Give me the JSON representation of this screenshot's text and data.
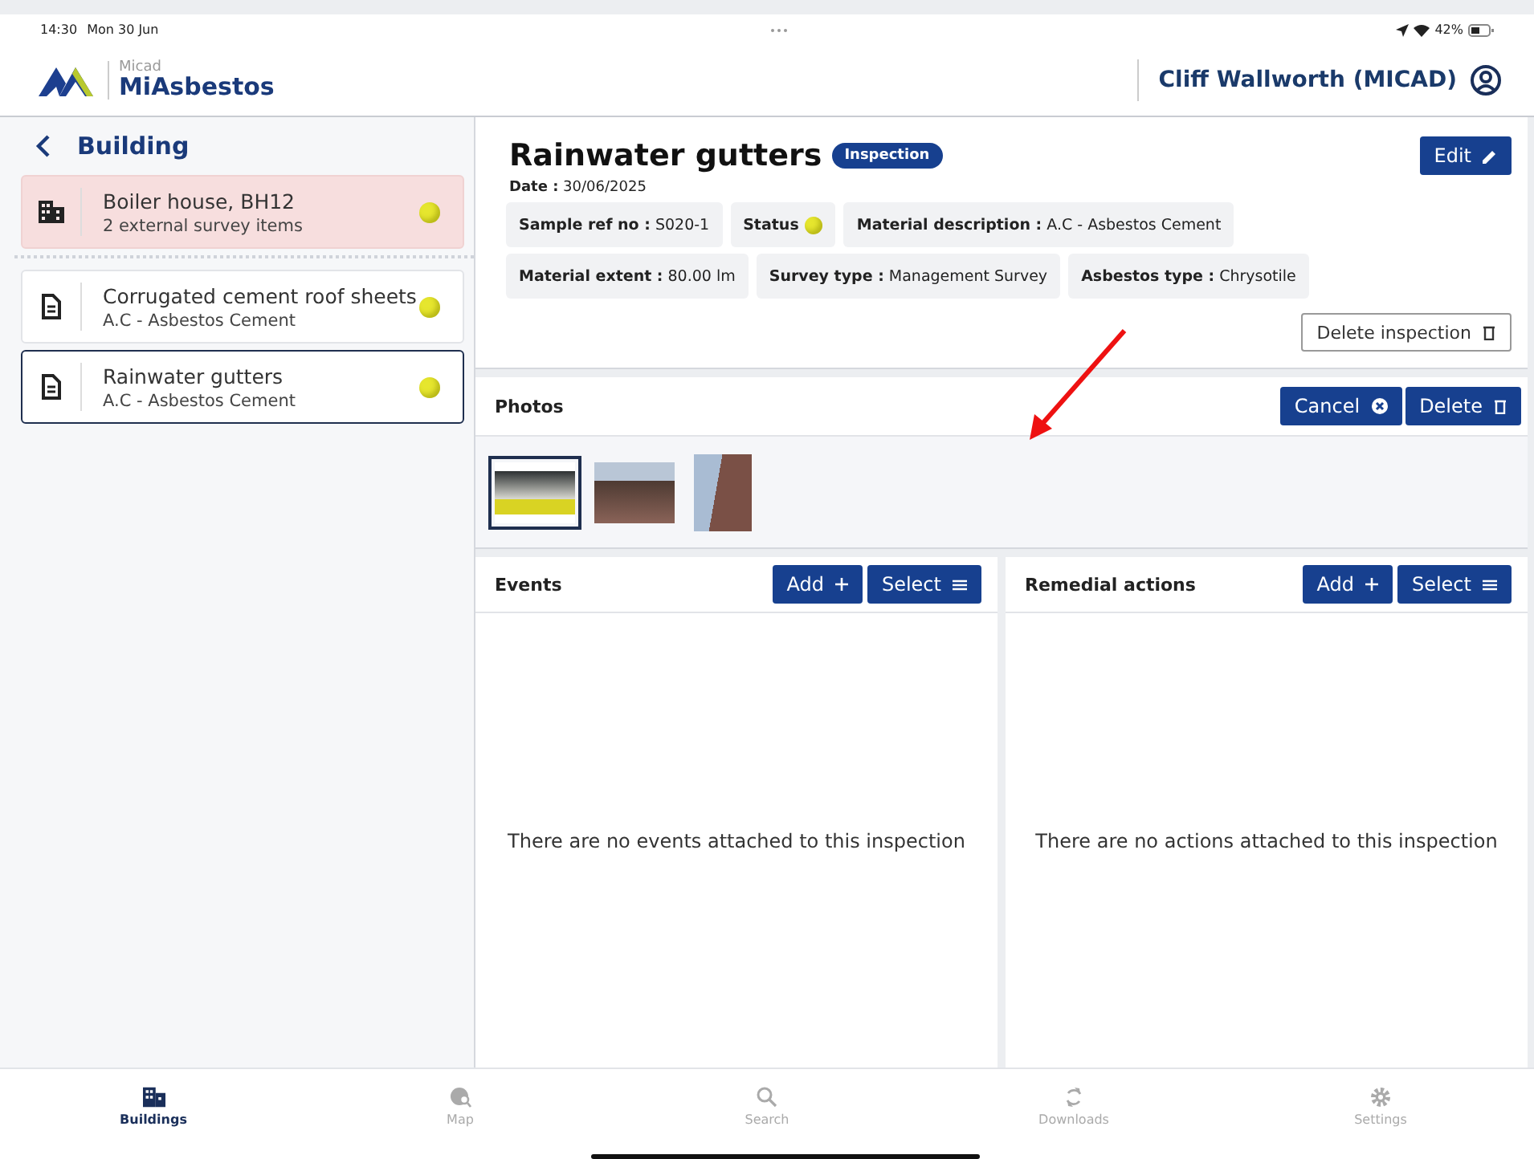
{
  "status_bar": {
    "time": "14:30",
    "date": "Mon 30 Jun",
    "battery": "42%"
  },
  "header": {
    "brand": "Micad",
    "app_name": "MiAsbestos",
    "user": "Cliff Wallworth (MICAD)"
  },
  "sidebar": {
    "title": "Building",
    "items": [
      {
        "kind": "building",
        "title": "Boiler house, BH12",
        "subtitle": "2 external survey items",
        "selected": false,
        "color": "#e6e62e"
      },
      {
        "kind": "item",
        "title": "Corrugated cement roof sheets",
        "subtitle": "A.C - Asbestos Cement",
        "selected": false,
        "color": "#e6e62e"
      },
      {
        "kind": "item",
        "title": "Rainwater gutters",
        "subtitle": "A.C - Asbestos Cement",
        "selected": true,
        "color": "#e6e62e"
      }
    ]
  },
  "detail": {
    "title": "Rainwater gutters",
    "badge": "Inspection",
    "edit_button": "Edit",
    "date_label": "Date :",
    "date": "30/06/2025",
    "fields": [
      {
        "kind": "text",
        "label": "Sample ref no :",
        "value": "S020-1"
      },
      {
        "kind": "status",
        "label": "Status",
        "color": "#e6e62e"
      },
      {
        "kind": "text",
        "label": "Material description :",
        "value": "A.C - Asbestos Cement"
      },
      {
        "kind": "text",
        "label": "Material extent :",
        "value": "80.00 lm"
      },
      {
        "kind": "text",
        "label": "Survey type :",
        "value": "Management Survey"
      },
      {
        "kind": "text",
        "label": "Asbestos type :",
        "value": "Chrysotile"
      }
    ],
    "delete_button": "Delete inspection"
  },
  "photos": {
    "title": "Photos",
    "cancel_button": "Cancel",
    "delete_button": "Delete",
    "items": [
      {
        "kind": "landscape",
        "selected": true
      },
      {
        "kind": "landscape",
        "selected": false
      },
      {
        "kind": "portrait",
        "selected": false
      }
    ]
  },
  "panels": [
    {
      "title": "Events",
      "add_button": "Add",
      "select_button": "Select",
      "empty_text": "There are no events attached to this inspection"
    },
    {
      "title": "Remedial actions",
      "add_button": "Add",
      "select_button": "Select",
      "empty_text": "There are no actions attached to this inspection"
    }
  ],
  "tabs": [
    {
      "kind": "buildings",
      "label": "Buildings",
      "selected": true
    },
    {
      "kind": "map",
      "label": "Map",
      "selected": false
    },
    {
      "kind": "search",
      "label": "Search",
      "selected": false
    },
    {
      "kind": "downloads",
      "label": "Downloads",
      "selected": false
    },
    {
      "kind": "settings",
      "label": "Settings",
      "selected": false
    }
  ]
}
